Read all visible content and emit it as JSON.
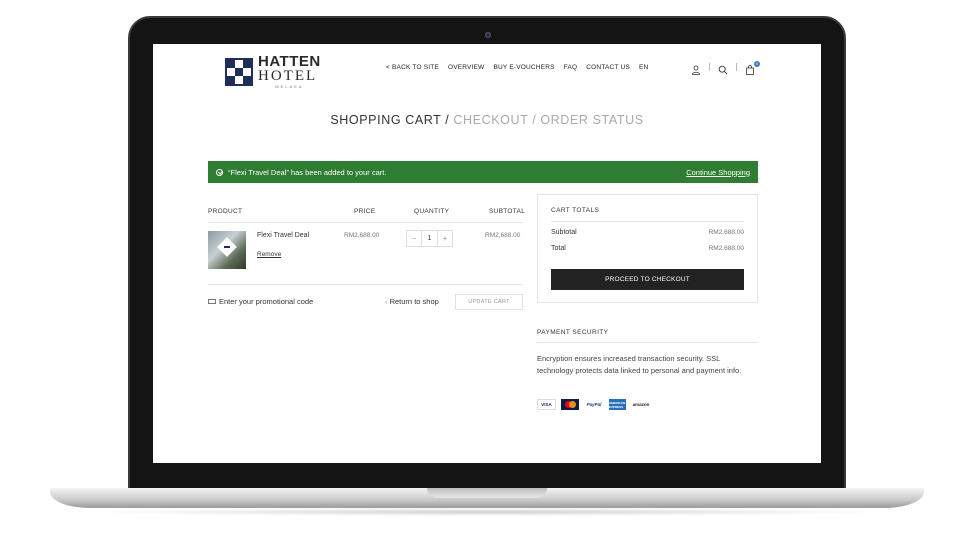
{
  "header": {
    "logo": {
      "line1": "HATTEN",
      "line2": "HOTEL",
      "line3": "MELAKA"
    },
    "nav": [
      "< BACK TO SITE",
      "OVERVIEW",
      "BUY E-VOUCHERS",
      "FAQ",
      "CONTACT US",
      "EN"
    ],
    "cart_count": "0",
    "icons": [
      "user-icon",
      "search-icon",
      "cart-icon"
    ]
  },
  "steps": {
    "current": "SHOPPING CART",
    "separator": " / ",
    "next1": "CHECKOUT",
    "next2": "ORDER STATUS"
  },
  "notice": {
    "message": "“Flexi Travel Deal” has been added to your cart.",
    "link": "Continue Shopping",
    "color": "#2e7d32"
  },
  "cart": {
    "columns": [
      "PRODUCT",
      "PRICE",
      "QUANTITY",
      "SUBTOTAL"
    ],
    "item": {
      "name": "Flexi Travel Deal",
      "remove": "Remove",
      "price": "RM2,688.00",
      "quantity": "1",
      "subtotal": "RM2,688.00"
    },
    "qty_minus": "−",
    "qty_plus": "+",
    "promo": "Enter your promotional code",
    "return": "Return to shop",
    "update": "UPDATE CART"
  },
  "totals": {
    "title": "CART TOTALS",
    "subtotal_label": "Subtotal",
    "subtotal_value": "RM2,688.00",
    "total_label": "Total",
    "total_value": "RM2,688.00",
    "checkout": "PROCEED TO CHECKOUT"
  },
  "payment": {
    "title": "PAYMENT SECURITY",
    "text": "Encryption ensures increased transaction security. SSL technology protects data linked to personal and payment info.",
    "logos": {
      "visa": "VISA",
      "paypal": "PayPal",
      "amex": "AMERICAN EXPRESS",
      "amazon": "amazon"
    }
  }
}
